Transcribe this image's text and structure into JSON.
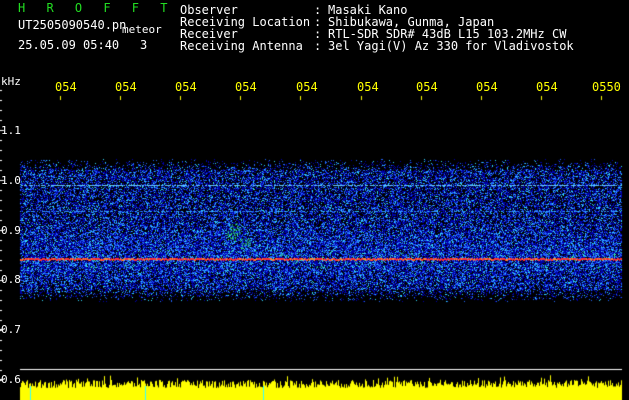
{
  "header": {
    "app_title": "H R O F F T",
    "filename": "UT2505090540.pn",
    "filename_suffix": "meteor",
    "datetime": "25.05.09 05:40",
    "count": "3",
    "info": [
      {
        "label": "Observer",
        "value": "Masaki Kano"
      },
      {
        "label": "Receiving Location",
        "value": "Shibukawa, Gunma, Japan"
      },
      {
        "label": "Receiver",
        "value": "RTL-SDR SDR# 43dB L15 103.2MHz CW"
      },
      {
        "label": "Receiving Antenna",
        "value": "3el Yagi(V) Az 330 for Vladivostok"
      }
    ]
  },
  "axes": {
    "y_unit": "kHz",
    "y_ticks": [
      "1.1",
      "1.0",
      "0.9",
      "0.8",
      "0.7",
      "0.6"
    ],
    "x_ticks": [
      "054",
      "054",
      "054",
      "054",
      "054",
      "054",
      "054",
      "054",
      "054",
      "0550"
    ]
  },
  "colors": {
    "background": "#000000",
    "noise_low": "#0000aa",
    "noise_mid": "#2266ff",
    "noise_high": "#33ddff",
    "signal_line": "#ff3333",
    "amplitude": "#ffff00",
    "title": "#22dd22",
    "ticks": "#ffff00"
  }
}
